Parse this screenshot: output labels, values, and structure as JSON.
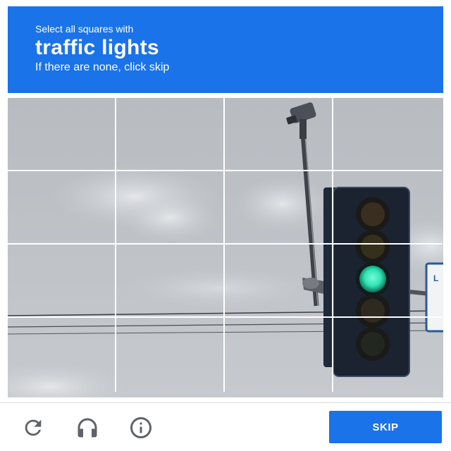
{
  "header": {
    "instruction": "Select all squares with",
    "target": "traffic lights",
    "hint": "If there are none, click skip"
  },
  "grid": {
    "rows": 4,
    "cols": 4
  },
  "footer": {
    "icons": [
      "reload-icon",
      "audio-headphones-icon",
      "info-icon"
    ],
    "skip_label": "SKIP"
  },
  "colors": {
    "header_bg": "#1a73e8",
    "button_bg": "#1a73e8",
    "icon_color": "#5f6368",
    "signal_green": "#2ee6b4"
  }
}
